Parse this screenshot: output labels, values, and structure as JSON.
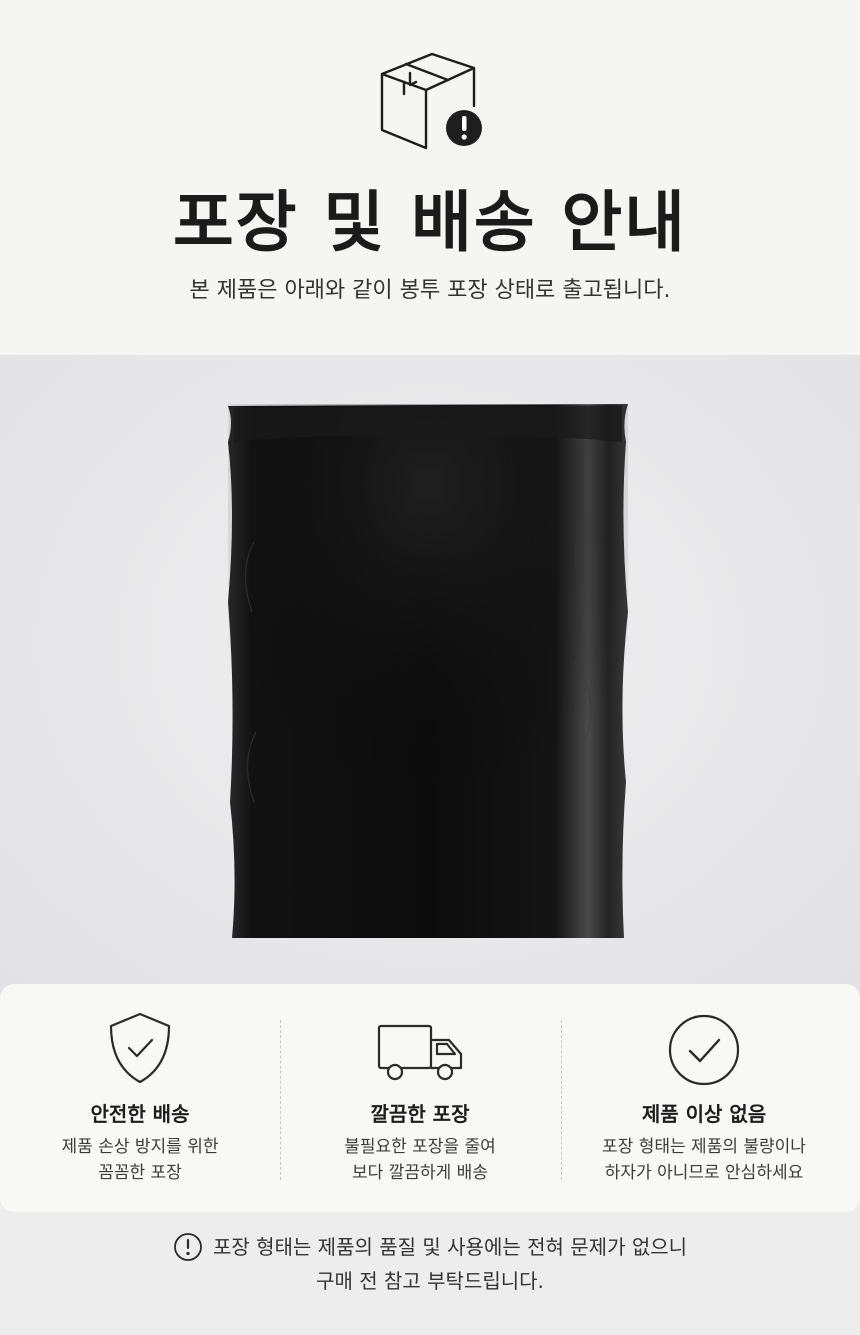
{
  "header": {
    "title": "포장 및 배송 안내",
    "subtitle": "본 제품은 아래와 같이 봉투 포장 상태로 출고됩니다.",
    "icon": "box-alert-icon"
  },
  "product": {
    "image": "black-poly-mailer-bag"
  },
  "features": [
    {
      "icon": "shield-check-icon",
      "title": "안전한 배송",
      "desc_line1": "제품 손상 방지를 위한",
      "desc_line2": "꼼꼼한 포장"
    },
    {
      "icon": "truck-icon",
      "title": "깔끔한 포장",
      "desc_line1": "불필요한 포장을 줄여",
      "desc_line2": "보다 깔끔하게 배송"
    },
    {
      "icon": "circle-check-icon",
      "title": "제품 이상 없음",
      "desc_line1": "포장 형태는 제품의 불량이나",
      "desc_line2": "하자가 아니므로 안심하세요"
    }
  ],
  "notice": {
    "icon": "info-alert-icon",
    "line1": "포장 형태는 제품의 품질 및 사용에는 전혀 문제가 없으니",
    "line2": "구매 전 참고 부탁드립니다."
  },
  "colors": {
    "text_dark": "#1b1b1b",
    "header_bg": "#f5f5f4",
    "product_bg": "#e6e6e8",
    "bag": "#111111"
  }
}
